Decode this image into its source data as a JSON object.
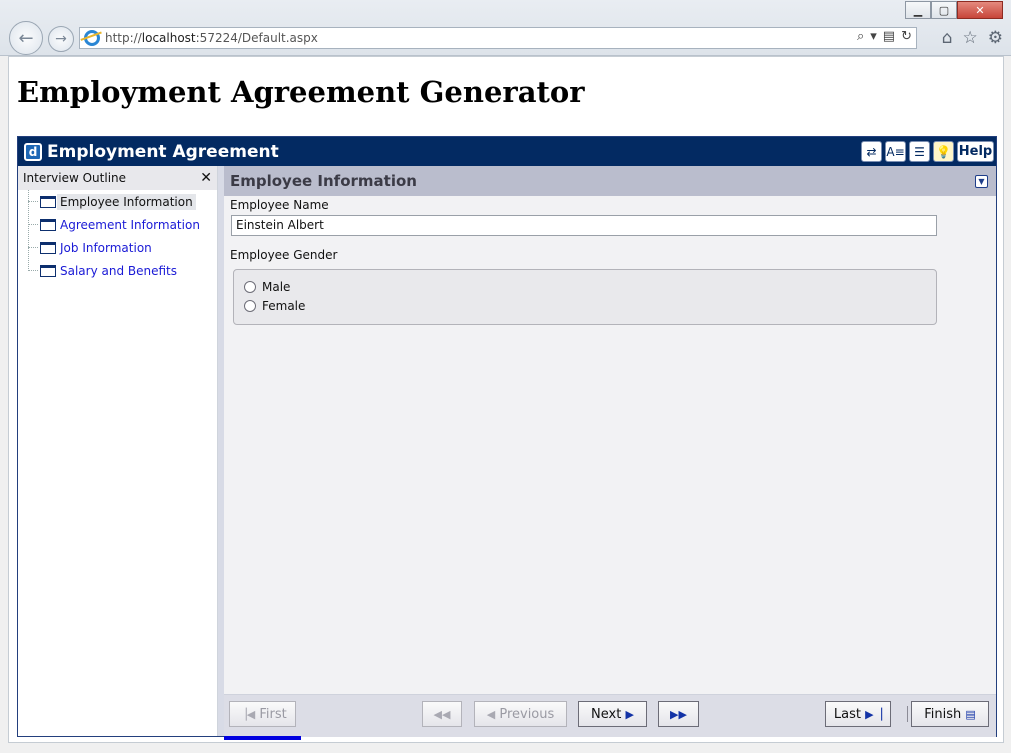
{
  "browser": {
    "url_prefix": "http://",
    "url_host": "localhost",
    "url_rest": ":57224/Default.aspx",
    "back_icon": "back-arrow-icon",
    "forward_icon": "forward-arrow-icon"
  },
  "page": {
    "title": "Employment Agreement Generator"
  },
  "widget": {
    "title": "Employment Agreement",
    "help_label": "Help",
    "outline": {
      "header": "Interview Outline",
      "items": [
        {
          "label": "Employee Information",
          "selected": true
        },
        {
          "label": "Agreement Information",
          "selected": false
        },
        {
          "label": "Job Information",
          "selected": false
        },
        {
          "label": "Salary and Benefits",
          "selected": false
        }
      ]
    },
    "dialog": {
      "title": "Employee Information",
      "name_label": "Employee Name",
      "name_value": "Einstein Albert",
      "gender_label": "Employee Gender",
      "gender_options": [
        "Male",
        "Female"
      ]
    },
    "nav": {
      "first": "First",
      "previous": "Previous",
      "next": "Next",
      "last": "Last",
      "finish": "Finish"
    }
  },
  "colors": {
    "header_bg": "#032a62",
    "link": "#1a1ad6",
    "dialog_header_bg": "#babdcd",
    "progress": "#0000e0"
  }
}
